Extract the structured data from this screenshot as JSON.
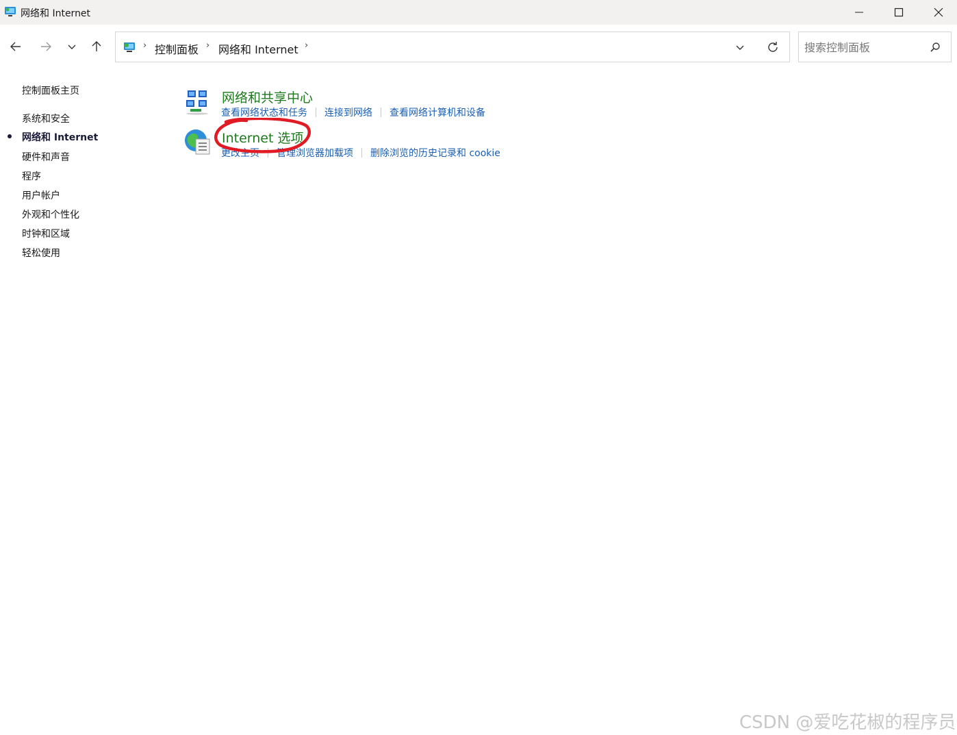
{
  "window": {
    "title": "网络和 Internet",
    "icons": {
      "app": "control-panel-icon",
      "minimize": "minimize-icon",
      "maximize": "maximize-icon",
      "close": "close-icon"
    }
  },
  "nav": {
    "icons": {
      "back": "arrow-left-icon",
      "forward": "arrow-right-icon",
      "recent": "chevron-down-icon",
      "up": "arrow-up-icon"
    }
  },
  "address": {
    "crumbs": [
      "控制面板",
      "网络和 Internet"
    ],
    "icons": {
      "root": "control-panel-icon",
      "dropdown": "chevron-down-icon",
      "refresh": "refresh-icon"
    }
  },
  "search": {
    "placeholder": "搜索控制面板",
    "icon": "search-icon"
  },
  "sidebar": {
    "home": "控制面板主页",
    "items": [
      "系统和安全",
      "网络和 Internet",
      "硬件和声音",
      "程序",
      "用户帐户",
      "外观和个性化",
      "时钟和区域",
      "轻松使用"
    ],
    "active_index": 1
  },
  "categories": [
    {
      "title": "网络和共享中心",
      "icon": "network-sharing-icon",
      "links": [
        "查看网络状态和任务",
        "连接到网络",
        "查看网络计算机和设备"
      ]
    },
    {
      "title": "Internet 选项",
      "icon": "internet-options-icon",
      "links": [
        "更改主页",
        "管理浏览器加载项",
        "删除浏览的历史记录和 cookie"
      ]
    }
  ],
  "annotation": {
    "color": "#e01b24"
  },
  "colors": {
    "category_title": "#1b7a1b",
    "link": "#1a5fb4"
  },
  "watermark": "CSDN @爱吃花椒的程序员"
}
